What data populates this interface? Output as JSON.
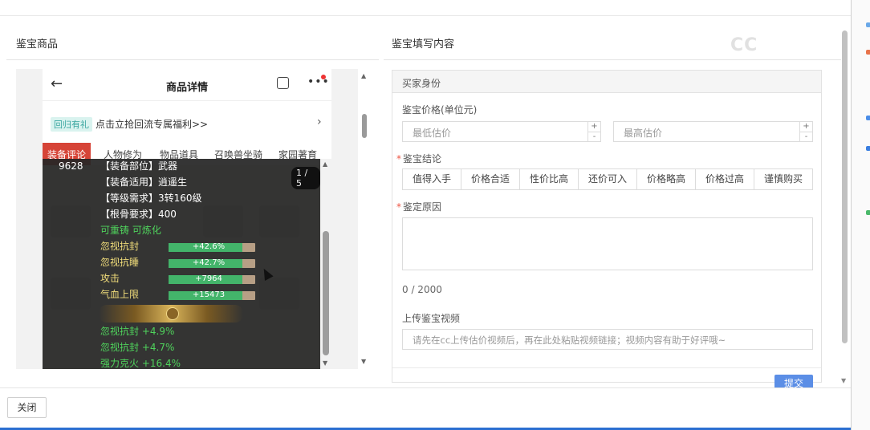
{
  "left": {
    "title": "鉴宝商品"
  },
  "right": {
    "title": "鉴宝填写内容"
  },
  "watermark": "CC",
  "phone": {
    "nav_title": "商品详情",
    "promo_tag": "回归有礼",
    "promo_text": "点击立抢回流专属福利>>",
    "tabs": [
      "装备评论",
      "人物修为",
      "物品道具",
      "召唤兽坐骑",
      "家园著育"
    ],
    "item": {
      "id": "9628",
      "pager": "1 / 5",
      "lines": [
        "【装备部位】武器",
        "【装备适用】逍遥生",
        "【等级需求】3转160级",
        "【根骨要求】400"
      ],
      "flags": "可重铸 可炼化",
      "bars": [
        {
          "name": "忽视抗封",
          "value": "+42.6%",
          "fill": 0.85
        },
        {
          "name": "忽视抗睡",
          "value": "+42.7%",
          "fill": 0.85
        },
        {
          "name": "攻击",
          "value": "+7964",
          "fill": 0.85
        },
        {
          "name": "气血上限",
          "value": "+15473",
          "fill": 0.85
        }
      ],
      "bonuses": [
        "忽视抗封 +4.9%",
        "忽视抗封 +4.7%",
        "强力克火 +16.4%"
      ]
    }
  },
  "form": {
    "section": "买家身份",
    "price_label": "鉴宝价格(单位元)",
    "min_placeholder": "最低估价",
    "max_placeholder": "最高估价",
    "conclusion_label": "鉴宝结论",
    "conclusions": [
      "值得入手",
      "价格合适",
      "性价比高",
      "还价可入",
      "价格略高",
      "价格过高",
      "谨慎购买"
    ],
    "reason_label": "鉴定原因",
    "counter": "0 / 2000",
    "video_label": "上传鉴宝视频",
    "video_placeholder": "请先在cc上传估价视频后，再在此处粘贴视频链接；视频内容有助于好评哦~",
    "submit": "提交",
    "required_mark": "*"
  },
  "footer": {
    "close": "关闭"
  },
  "colors": {
    "accent": "#5b8ee6",
    "tab_active": "#d64437",
    "bar_fill": "#43b46a",
    "text_green": "#4fd35c"
  }
}
